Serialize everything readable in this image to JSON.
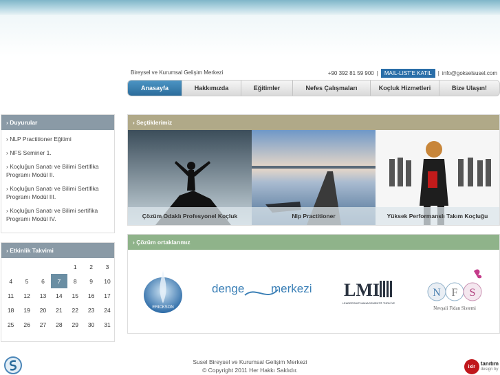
{
  "header": {
    "tagline": "Bireysel ve Kurumsal Gelişim Merkezi",
    "phone": "+90 392 81 59 900",
    "separator": "|",
    "mail_list_label": "MAIL-LIST'E KATIL",
    "email": "info@gokselsusel.com"
  },
  "nav": {
    "items": [
      "Anasayfa",
      "Hakkımızda",
      "Eğitimler",
      "Nefes Çalışmaları",
      "Koçluk Hizmetleri",
      "Bize Ulaşın!"
    ],
    "active": "Anasayfa"
  },
  "duyurular": {
    "title": "› Duyurular",
    "items": [
      "› NLP Practitioner Eğitimi",
      "› NFS Seminer 1.",
      "› Koçluğun Sanatı ve Bilimi Sertifika Programı Modül II.",
      "› Koçluğun Sanatı ve Bilimi Sertifika Programı Modül III.",
      "› Koçluğun Sanatı ve Bilimi sertifika Programı Modül IV."
    ]
  },
  "etkinlik": {
    "title": "› Etkinlik Takvimi",
    "days": [
      "",
      "",
      "",
      "",
      "1",
      "2",
      "3",
      "4",
      "5",
      "6",
      "7",
      "8",
      "9",
      "10",
      "11",
      "12",
      "13",
      "14",
      "15",
      "16",
      "17",
      "18",
      "19",
      "20",
      "21",
      "22",
      "23",
      "24",
      "25",
      "26",
      "27",
      "28",
      "29",
      "30",
      "31"
    ],
    "today": "7"
  },
  "sectiklerimiz": {
    "title": "› Seçtiklerimiz",
    "items": [
      {
        "caption": "Çözüm Odaklı Profesyonel Koçluk"
      },
      {
        "caption": "Nlp Practitioner"
      },
      {
        "caption": "Yüksek Performanslı Takım Koçluğu"
      }
    ]
  },
  "ortaklar": {
    "title": "› Çözüm ortaklarımız",
    "erickson_text": "ERICKSON",
    "denge_text": "denge",
    "merkezi_text": "merkezi",
    "lmi_text": "LMI",
    "lmi_sub": "LEADERSHIP MANAGEMENT® TÜRKİYE",
    "nfs_letters": [
      "N",
      "F",
      "S"
    ],
    "nfs_sub": "Nevşali Fidan Sistemi"
  },
  "footer": {
    "line1": "Susel Bireysel ve Kurumsal Gelişim Merkezi",
    "line2": "© Copyright 2011 Her Hakkı Saklıdır.",
    "design_brand": "ixir",
    "design_name": "tanıtım",
    "design_by": "design by"
  },
  "colors": {
    "accent": "#2b6c9b",
    "sidebar_header": "#8a9aa6",
    "sec_header": "#b0a988",
    "partner_header": "#8fb38a"
  }
}
